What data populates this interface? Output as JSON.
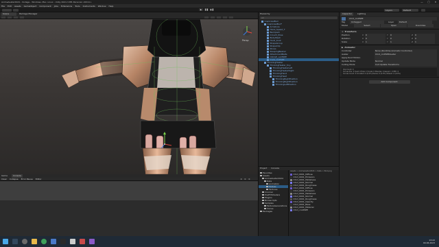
{
  "window": {
    "title": "AnimeAvatar2024 - Vorlage - Windows, Mac, Linux - Unity 2021.3.8f1 Personal <DX11>",
    "controls": [
      "—",
      "□",
      "✕"
    ]
  },
  "menu": [
    "File",
    "Edit",
    "Assets",
    "GameObject",
    "Component",
    "Jobs",
    "Extensions",
    "Tools",
    "Instruments",
    "Window",
    "Help"
  ],
  "toolbar": {
    "play": "▶",
    "pause": "❚❚",
    "step": "▶❚",
    "layers": "Layers",
    "layout": "Default"
  },
  "scene": {
    "tabs": [
      "Scene",
      "Package Manager"
    ],
    "view_label": "Persp",
    "ui_hint": "UI"
  },
  "console": {
    "tabs": [
      "Game",
      "Console"
    ],
    "toolbar": [
      "Clear",
      "Collapse",
      "Error Pause",
      "Editor"
    ],
    "counts": [
      "0",
      "0",
      "0"
    ]
  },
  "hierarchy": {
    "title": "Hierarchy",
    "search_placeholder": "All",
    "items": [
      {
        "label": "CoqCrawlBod",
        "depth": 0
      },
      {
        "label": "CoqCrawlBod*",
        "depth": 1
      },
      {
        "label": "Armature",
        "depth": 2
      },
      {
        "label": "Hand_Speed_T",
        "depth": 2
      },
      {
        "label": "Backpack",
        "depth": 2
      },
      {
        "label": "Crouch_Pose",
        "depth": 2
      },
      {
        "label": "BodyMesh",
        "depth": 2
      },
      {
        "label": "Hood_Knot",
        "depth": 2
      },
      {
        "label": "ShapeGroup",
        "depth": 2
      },
      {
        "label": "ShapeClip",
        "depth": 2
      },
      {
        "label": "Shoes",
        "depth": 2
      },
      {
        "label": "SleepingBeaker",
        "depth": 2
      },
      {
        "label": "AttachmentBelts",
        "depth": 2
      },
      {
        "label": "OOOLE_outPSEE",
        "depth": 2
      },
      {
        "label": "Cnnk_cinPSEE",
        "depth": 2
      },
      {
        "label": "ThinkingHeater",
        "depth": 1
      },
      {
        "label": "ThinkingHeater_tiny",
        "depth": 2
      },
      {
        "label": "ThinkingHeaterLeft",
        "depth": 3
      },
      {
        "label": "ThinkingHeaterRight",
        "depth": 3
      },
      {
        "label": "ThinkingHand",
        "depth": 3
      },
      {
        "label": "ThinkingHead",
        "depth": 3
      },
      {
        "label": "ThinkingRightPosition",
        "depth": 4
      },
      {
        "label": "ThinkingRightPosition",
        "depth": 4
      },
      {
        "label": "ThinkingLeftPosition",
        "depth": 4
      }
    ]
  },
  "project": {
    "tabs": [
      "Project",
      "Console"
    ],
    "tree": [
      {
        "label": "Favorites",
        "depth": 0
      },
      {
        "label": "Assets",
        "depth": 0
      },
      {
        "label": "AnimeAvatar2024",
        "depth": 1
      },
      {
        "label": "Data",
        "depth": 2
      },
      {
        "label": "Animation",
        "depth": 3
      },
      {
        "label": "Models",
        "depth": 3
      },
      {
        "label": "Textures",
        "depth": 3
      },
      {
        "label": "Crunner",
        "depth": 1
      },
      {
        "label": "PostFXShaders",
        "depth": 1
      },
      {
        "label": "Plugins",
        "depth": 1
      },
      {
        "label": "Bonescripts",
        "depth": 1
      },
      {
        "label": "Samples",
        "depth": 1
      },
      {
        "label": "TextureGenerations",
        "depth": 2
      },
      {
        "label": "Voices",
        "depth": 2
      },
      {
        "label": "Packages",
        "depth": 0
      }
    ],
    "breadcrumb": "Assets > AnimeAvatar2024 > Data > Mod.png",
    "files": [
      "Chrd_0001_Diffuse",
      "Chrd_0001_Emission",
      "Chrd_0001_Metalness",
      "Chrd_0001_Normal",
      "Chrd_0001_Roughness",
      "Chrd_0001_Diffuse",
      "Chrd_0001_Emission",
      "Chrd_0001_Metalness",
      "Chrd_0001_Normal",
      "Chrd_0001_Roughness",
      "Chrd_0001_Opacity",
      "Chrd_0001_Base",
      "Chrd_0001_Material",
      "Chrd_cnnPSEE"
    ]
  },
  "inspector": {
    "tabs": [
      "Inspector",
      "Lighting"
    ],
    "object_name": "Chrd_cinPSEE",
    "tag_label": "Tag",
    "tag_value": "Untagged",
    "layer_label": "Layer",
    "layer_value": "Default",
    "model_label": "Model",
    "model_buttons": [
      "Select",
      "Open",
      "Overrides"
    ],
    "transform": {
      "title": "Transform",
      "rows": [
        {
          "label": "Position",
          "x": "0",
          "y": "0",
          "z": "0"
        },
        {
          "label": "Rotation",
          "x": "0",
          "y": "0",
          "z": "0"
        },
        {
          "label": "Scale",
          "x": "1",
          "y": "1",
          "z": "1"
        }
      ]
    },
    "animator": {
      "title": "Animator",
      "rows": [
        {
          "label": "Controller",
          "value": "None (Runtime Animator Controller)"
        },
        {
          "label": "Avatar",
          "value": "Chrd_cinPSEEAvatar"
        },
        {
          "label": "Apply Root Motion",
          "value": ""
        },
        {
          "label": "Update Mode",
          "value": "Normal"
        },
        {
          "label": "Culling Mode",
          "value": "Cull Update Transforms"
        }
      ],
      "info": "Clip Count: 0\nCurves Pos: 0 Quat: 0 Euler: 0 Scale: 0 Muscles: 0 Generic: 0 PPtr: 0\nCurves Count: 0 Constant: 0 (0.0%) Dense: 0 (0.0%) Stream: 0 (0.0%)"
    },
    "add_component": "Add Component"
  },
  "taskbar": {
    "time": "13:22",
    "date": "09.06.2023"
  },
  "colors": {
    "accent": "#3d6dbb",
    "selection": "#2c5d87",
    "panel": "#232323",
    "scene_bg": "#2a2928",
    "ground": "#d9e2ea"
  }
}
